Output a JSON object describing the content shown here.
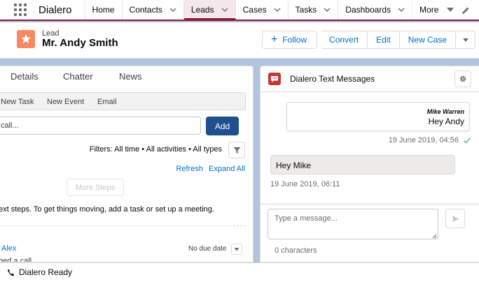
{
  "nav": {
    "app_name": "Dialero",
    "items": [
      {
        "label": "Home",
        "has_dropdown": false
      },
      {
        "label": "Contacts",
        "has_dropdown": true
      },
      {
        "label": "Leads",
        "has_dropdown": true,
        "active": true
      },
      {
        "label": "Cases",
        "has_dropdown": true
      },
      {
        "label": "Tasks",
        "has_dropdown": true
      },
      {
        "label": "Dashboards",
        "has_dropdown": true
      },
      {
        "label": "More",
        "has_dropdown": true
      }
    ],
    "accent_color": "#8e1b3b"
  },
  "record": {
    "object_label": "Lead",
    "name": "Mr. Andy Smith",
    "icon": "lead-icon",
    "icon_color": "#f88962",
    "buttons": {
      "follow": "Follow",
      "convert": "Convert",
      "edit": "Edit",
      "new_case": "New Case"
    }
  },
  "activity": {
    "tabs": [
      "Details",
      "Chatter",
      "News"
    ],
    "actions": [
      "New Task",
      "New Event",
      "Email"
    ],
    "call_input_value": "call...",
    "add_label": "Add",
    "filters_text": "Filters: All time • All activities • All types",
    "refresh_label": "Refresh",
    "expand_label": "Expand All",
    "more_steps_label": "More Steps",
    "no_steps_text": "ext steps. To get things moving, add a task or set up a meeting.",
    "item": {
      "who": "Alex",
      "due": "No due date",
      "summary": "ged a call"
    }
  },
  "sms": {
    "title": "Dialero Text Messages",
    "icon_color": "#c23934",
    "outgoing": {
      "sender": "Mike Warren",
      "text": "Hey Andy",
      "time": "19 June 2019, 04:56"
    },
    "incoming": {
      "text": "Hey Mike",
      "time": "19 June 2019, 06:11"
    },
    "placeholder": "Type a message...",
    "char_count": "0 characters"
  },
  "utility": {
    "label": "Dialero Ready"
  }
}
